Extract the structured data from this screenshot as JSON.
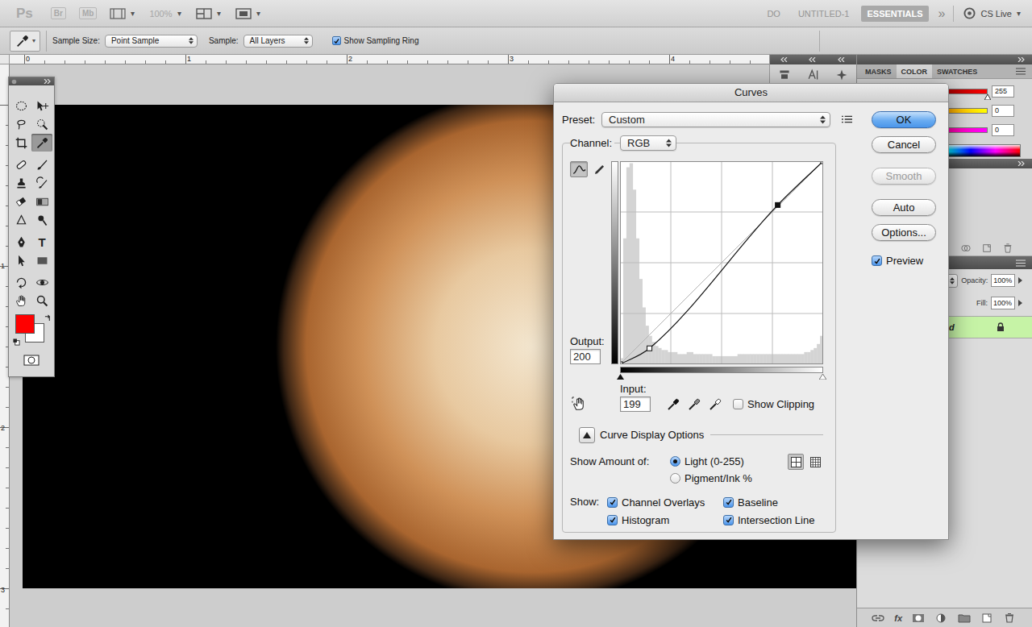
{
  "app_bar": {
    "logos": [
      "Ps",
      "Br",
      "Mb"
    ],
    "caret": "▾",
    "zoom": {
      "label": "100%",
      "disabled": true
    },
    "workspaces": [
      {
        "label": "DO",
        "selected": false
      },
      {
        "label": "UNTITLED-1",
        "selected": false
      },
      {
        "label": "ESSENTIALS",
        "selected": true
      }
    ],
    "more": "»",
    "cs_live": "CS Live"
  },
  "options_bar": {
    "sample_size": {
      "label": "Sample Size:",
      "value": "Point Sample"
    },
    "sample": {
      "label": "Sample:",
      "value": "All Layers"
    },
    "sampling_ring": {
      "label": "Show Sampling Ring",
      "checked": true
    }
  },
  "rulers": {
    "horizontal": [
      "0",
      "1",
      "2",
      "3",
      "4"
    ],
    "vertical": [
      "1",
      "2",
      "3"
    ]
  },
  "toolbox": {
    "tools": [
      {
        "kind": "marquee",
        "selected": false
      },
      {
        "kind": "move",
        "selected": false
      },
      {
        "kind": "lasso",
        "selected": false
      },
      {
        "kind": "quick",
        "selected": false
      },
      {
        "kind": "crop",
        "selected": false
      },
      {
        "kind": "eyedropper",
        "selected": true
      },
      {
        "kind": "heal",
        "selected": false
      },
      {
        "kind": "brush",
        "selected": false
      },
      {
        "kind": "stamp",
        "selected": false
      },
      {
        "kind": "history",
        "selected": false
      },
      {
        "kind": "eraser",
        "selected": false
      },
      {
        "kind": "gradient",
        "selected": false
      },
      {
        "kind": "blur",
        "selected": false
      },
      {
        "kind": "dodge",
        "selected": false
      },
      {
        "kind": "pen",
        "selected": false
      },
      {
        "kind": "type",
        "glyph": "T",
        "selected": false
      },
      {
        "kind": "path",
        "selected": false
      },
      {
        "kind": "rect",
        "selected": false
      },
      {
        "kind": "rotate",
        "selected": false
      },
      {
        "kind": "orbit",
        "selected": false
      },
      {
        "kind": "hand",
        "selected": false
      },
      {
        "kind": "zoom",
        "selected": false
      }
    ],
    "swatches": [
      {
        "kind": "background",
        "color": "#ffffff"
      },
      {
        "kind": "foreground",
        "color": "#ff0000"
      }
    ]
  },
  "panels": {
    "tabs": [
      {
        "label": "MASKS",
        "selected": false
      },
      {
        "label": "COLOR",
        "selected": true
      },
      {
        "label": "SWATCHES",
        "selected": false
      }
    ],
    "color_sliders": [
      {
        "value": "255",
        "level": 1,
        "gradient": [
          "#000000",
          "#ff0000"
        ]
      },
      {
        "value": "0",
        "level": 0,
        "gradient": [
          "#ff0000",
          "#ffff00"
        ]
      },
      {
        "value": "0",
        "level": 0,
        "gradient": [
          "#ff0000",
          "#ff00ff"
        ]
      }
    ],
    "layers": {
      "opacity": {
        "label": "Opacity:",
        "value": "100%"
      },
      "fill": {
        "label": "Fill:",
        "value": "100%"
      },
      "items": [
        {
          "name": "d",
          "selected": true,
          "locked": true
        }
      ],
      "fx_label": "fx"
    }
  },
  "curves_dialog": {
    "title": "Curves",
    "preset": {
      "label": "Preset:",
      "value": "Custom"
    },
    "channel": {
      "label": "Channel:",
      "value": "RGB"
    },
    "edit_modes": [
      {
        "kind": "curve",
        "selected": true
      },
      {
        "kind": "pencil",
        "selected": false
      }
    ],
    "output": {
      "label": "Output:",
      "value": "200"
    },
    "input": {
      "label": "Input:",
      "value": "199"
    },
    "curve_points": [
      {
        "input": 0,
        "output": 0,
        "selected": false
      },
      {
        "input": 37,
        "output": 20,
        "selected": false
      },
      {
        "input": 198,
        "output": 200,
        "selected": true
      },
      {
        "input": 255,
        "output": 255,
        "selected": false
      }
    ],
    "histogram": [
      0.03,
      0.62,
      0.97,
      0.99,
      0.86,
      0.62,
      0.42,
      0.28,
      0.19,
      0.14,
      0.11,
      0.09,
      0.08,
      0.07,
      0.07,
      0.06,
      0.06,
      0.06,
      0.05,
      0.05,
      0.05,
      0.06,
      0.06,
      0.05,
      0.05,
      0.05,
      0.05,
      0.05,
      0.05,
      0.04,
      0.04,
      0.04,
      0.04,
      0.04,
      0.04,
      0.04,
      0.04,
      0.05,
      0.05,
      0.05,
      0.05,
      0.05,
      0.05,
      0.05,
      0.05,
      0.05,
      0.05,
      0.05,
      0.05,
      0.05,
      0.05,
      0.05,
      0.05,
      0.05,
      0.05,
      0.05,
      0.05,
      0.05,
      0.06,
      0.06,
      0.07,
      0.08,
      0.1,
      0.14
    ],
    "samplers": [
      {
        "kind": "black"
      },
      {
        "kind": "gray"
      },
      {
        "kind": "white"
      }
    ],
    "show_clipping": {
      "label": "Show Clipping",
      "checked": false
    },
    "display_options": {
      "label": "Curve Display Options",
      "expanded": true
    },
    "show_amount": {
      "label": "Show Amount of:",
      "options": [
        {
          "label": "Light (0-255)",
          "selected": true
        },
        {
          "label": "Pigment/Ink %",
          "selected": false
        }
      ]
    },
    "grid_sizes": [
      {
        "kind": "simple",
        "selected": true
      },
      {
        "kind": "detailed",
        "selected": false
      }
    ],
    "show": {
      "label": "Show:",
      "options": [
        {
          "label": "Channel Overlays",
          "checked": true
        },
        {
          "label": "Histogram",
          "checked": true
        },
        {
          "label": "Baseline",
          "checked": true
        },
        {
          "label": "Intersection Line",
          "checked": true
        }
      ]
    },
    "buttons": [
      {
        "label": "OK",
        "default": true,
        "disabled": false
      },
      {
        "label": "Cancel",
        "default": false,
        "disabled": false
      },
      {
        "label": "Smooth",
        "default": false,
        "disabled": true
      },
      {
        "label": "Auto",
        "default": false,
        "disabled": false
      },
      {
        "label": "Options...",
        "default": false,
        "disabled": false
      }
    ],
    "preview": {
      "label": "Preview",
      "checked": true
    }
  }
}
